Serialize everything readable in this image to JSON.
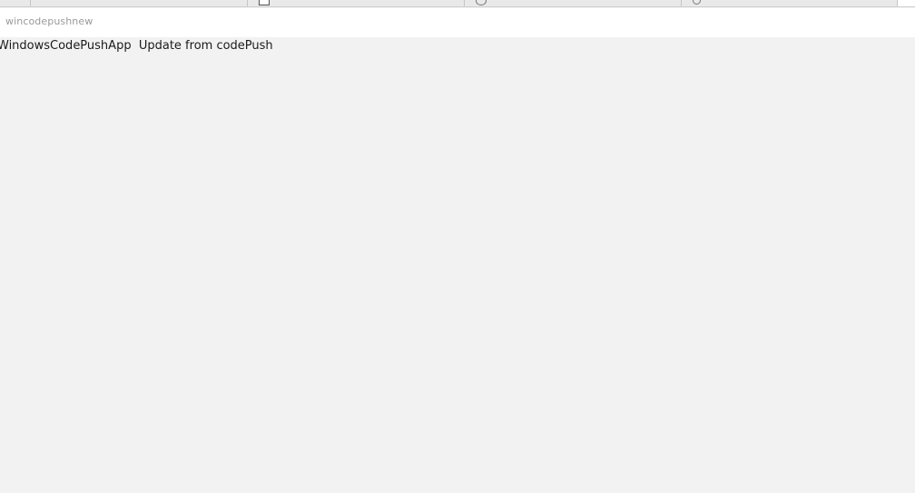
{
  "window": {
    "title": "wincodepushnew"
  },
  "taskbar": {
    "tabs": [
      {
        "icon": "blank-icon"
      },
      {
        "icon": "window-icon"
      },
      {
        "icon": "app-icon"
      },
      {
        "icon": "search-icon"
      }
    ]
  },
  "content": {
    "app_name": "WindowsCodePushApp",
    "message": "Update from codePush"
  }
}
